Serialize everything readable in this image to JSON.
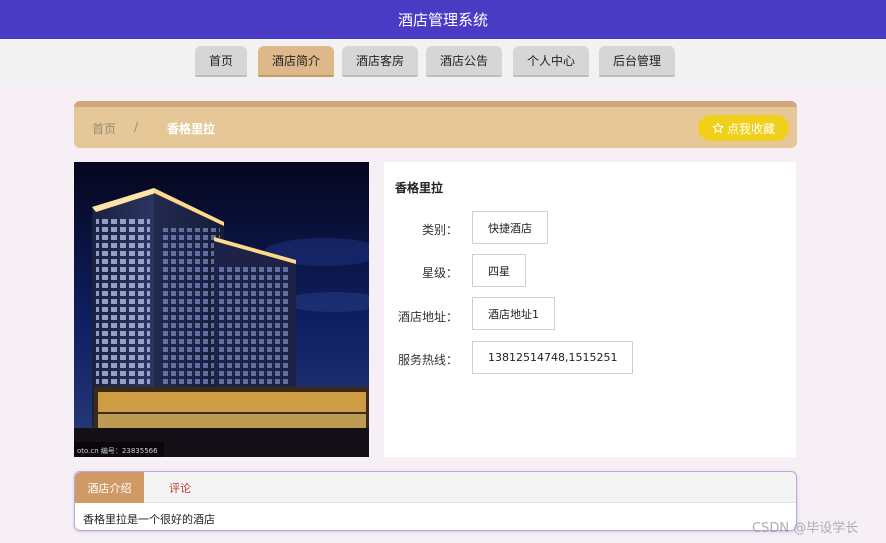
{
  "app": {
    "title": "酒店管理系统"
  },
  "nav": {
    "items": [
      {
        "label": "首页",
        "active": false
      },
      {
        "label": "酒店简介",
        "active": true
      },
      {
        "label": "酒店客房",
        "active": false
      },
      {
        "label": "酒店公告",
        "active": false
      },
      {
        "label": "个人中心",
        "active": false
      },
      {
        "label": "后台管理",
        "active": false
      }
    ]
  },
  "breadcrumb": {
    "home": "首页",
    "separator": "/",
    "current": "香格里拉"
  },
  "favorite": {
    "icon": "star-outline-icon",
    "label": "点我收藏"
  },
  "photo": {
    "caption": "oto.cn  编号：23835566"
  },
  "hotel": {
    "name": "香格里拉",
    "fields": [
      {
        "label": "类别：",
        "value": "快捷酒店"
      },
      {
        "label": "星级：",
        "value": "四星"
      },
      {
        "label": "酒店地址：",
        "value": "酒店地址1"
      },
      {
        "label": "服务热线：",
        "value": "13812514748,1515251"
      }
    ]
  },
  "tabs": {
    "items": [
      {
        "label": "酒店介绍"
      },
      {
        "label": "评论"
      }
    ],
    "content": "香格里拉是一个很好的酒店"
  },
  "watermark": "CSDN @毕设学长",
  "colors": {
    "header": "#4a3bc4",
    "nav_active": "#dcb88a",
    "crumb_bar": "#e6c898",
    "favorite": "#f1d01c",
    "tab_active": "#cf9a66",
    "comment_tab": "#c0392b"
  }
}
